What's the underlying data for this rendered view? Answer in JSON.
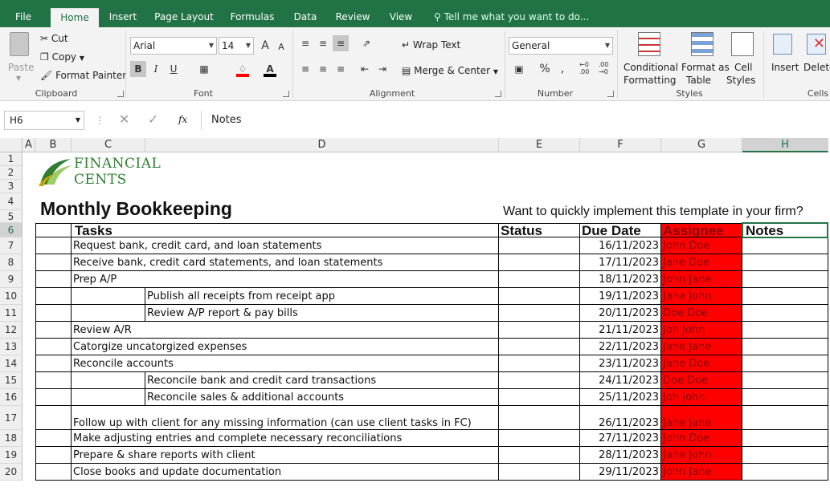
{
  "tabs": [
    "File",
    "Home",
    "Insert",
    "Page Layout",
    "Formulas",
    "Data",
    "Review",
    "View"
  ],
  "active_tab": "Home",
  "tell_me": "Tell me what you want to do...",
  "clipboard": {
    "paste": "Paste",
    "cut": "Cut",
    "copy": "Copy",
    "format_painter": "Format Painter",
    "label": "Clipboard"
  },
  "font": {
    "name": "Arial",
    "size": "14",
    "bold": "B",
    "italic": "I",
    "underline": "U",
    "grow": "A",
    "shrink": "A",
    "font_color": "A",
    "label": "Font"
  },
  "alignment": {
    "wrap_text": "Wrap Text",
    "merge_center": "Merge & Center",
    "label": "Alignment"
  },
  "number": {
    "format": "General",
    "percent": "%",
    "comma": ",",
    "inc_decimal": "←0 .00",
    "dec_decimal": ".00 →0",
    "label": "Number"
  },
  "styles": {
    "conditional_1": "Conditional",
    "conditional_2": "Formatting",
    "format_table_1": "Format as",
    "format_table_2": "Table",
    "cell_styles_1": "Cell",
    "cell_styles_2": "Styles",
    "label": "Styles"
  },
  "cells": {
    "insert": "Insert",
    "delete": "Delete",
    "label": "Cells"
  },
  "namebox": "H6",
  "formula_value": "Notes",
  "fx": "fx",
  "columns": [
    "A",
    "B",
    "C",
    "D",
    "E",
    "F",
    "G",
    "H"
  ],
  "rows": [
    "1",
    "2",
    "3",
    "4",
    "5",
    "6",
    "7",
    "8",
    "9",
    "10",
    "11",
    "12",
    "13",
    "14",
    "15",
    "16",
    "17",
    "18",
    "19",
    "20"
  ],
  "logo": {
    "line1": "FINANCIAL",
    "line2": "CENTS"
  },
  "title": "Monthly Bookkeeping",
  "promo": "Want to quickly implement this template in your firm?",
  "headers": {
    "tasks": "Tasks",
    "status": "Status",
    "due_date": "Due Date",
    "assignee": "Assignee",
    "notes": "Notes"
  },
  "tasks": [
    {
      "text": "Request bank, credit card, and loan statements",
      "indent": false,
      "due": "16/11/2023",
      "assignee": "John Doe"
    },
    {
      "text": "Receive bank, credit card statements, and loan statements",
      "indent": false,
      "due": "17/11/2023",
      "assignee": "Jane Doe"
    },
    {
      "text": "Prep A/P",
      "indent": false,
      "due": "18/11/2023",
      "assignee": "John Jane"
    },
    {
      "text": "Publish all receipts from receipt app",
      "indent": true,
      "due": "19/11/2023",
      "assignee": "Jane John"
    },
    {
      "text": "Review A/P report & pay bills",
      "indent": true,
      "due": "20/11/2023",
      "assignee": "Doe Doe"
    },
    {
      "text": "Review A/R",
      "indent": false,
      "due": "21/11/2023",
      "assignee": "Joh John"
    },
    {
      "text": "Catorgize uncatorgized expenses",
      "indent": false,
      "due": "22/11/2023",
      "assignee": "Jane Jane"
    },
    {
      "text": "Reconcile accounts",
      "indent": false,
      "due": "23/11/2023",
      "assignee": "Jane Doe"
    },
    {
      "text": "Reconcile bank and credit card transactions",
      "indent": true,
      "due": "24/11/2023",
      "assignee": "Doe Doe"
    },
    {
      "text": "Reconcile sales & additional accounts",
      "indent": true,
      "due": "25/11/2023",
      "assignee": "Joh John"
    },
    {
      "text": "Follow up with client for any missing information (can use client tasks in FC)",
      "indent": false,
      "due": "26/11/2023",
      "assignee": "Jane Jane"
    },
    {
      "text": "Make adjusting entries and complete necessary reconciliations",
      "indent": false,
      "due": "27/11/2023",
      "assignee": "John Doe"
    },
    {
      "text": "Prepare & share reports with client",
      "indent": false,
      "due": "28/11/2023",
      "assignee": "Jane John"
    },
    {
      "text": "Close books and update documentation",
      "indent": false,
      "due": "29/11/2023",
      "assignee": "John Jane"
    }
  ],
  "colors": {
    "excel_green": "#217346",
    "assignee_red": "#ff0000",
    "logo_green": "#2e7d32"
  }
}
